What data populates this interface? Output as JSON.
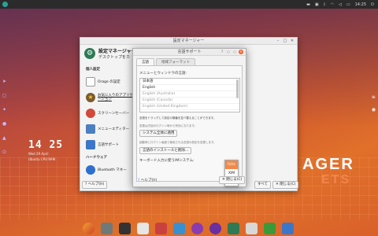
{
  "tray": {
    "time": "14:25"
  },
  "desktop": {
    "clock": "14 25",
    "date": "Wed  29  April",
    "info": "Ubuntu  CPU  RAM",
    "word1": "AGER",
    "word2": "ETS"
  },
  "main_window": {
    "title": "設定マネージャー",
    "header_title": "設定マネージャー",
    "header_subtitle": "デスクトップをカ",
    "category_personal": "個人設定",
    "category_hardware": "ハードウェア",
    "items": [
      {
        "label": "Orage の設定",
        "underline": false
      },
      {
        "label": "お気に入りのアプリケーション",
        "underline": true
      },
      {
        "label": "スクリーンセーバー",
        "underline": false
      },
      {
        "label": "メニューエディター",
        "underline": false
      },
      {
        "label": "言語サポート",
        "underline": false
      },
      {
        "label": "Bluetooth マネー",
        "underline": false
      }
    ],
    "help_button": "ヘルプ(H)",
    "close_button": "閉じる(C)",
    "all_button": "すべて"
  },
  "dialog": {
    "title": "言語サポート",
    "tabs": [
      "言語",
      "地域フォーマット"
    ],
    "section_label": "メニューとウィンドウの言語:",
    "languages": [
      {
        "name": "日本語",
        "dim": false
      },
      {
        "name": "English",
        "dim": false
      },
      {
        "name": "English (Australia)",
        "dim": true
      },
      {
        "name": "English (Canada)",
        "dim": true
      },
      {
        "name": "English (United Kingdom)",
        "dim": true
      }
    ],
    "hint1": "言語をドラッグして設定の順番を並べ替えることができます。",
    "hint1b": "変更は次回のログイン時から有効になります。",
    "apply_button": "システム全体に適用",
    "hint2": "起動時とログイン画面で使用される言語の設定を変更します。",
    "install_button": "言語のインストールと削除...",
    "keyboard_label": "キーボード入力に使うIMシステム:",
    "popup_options": [
      "fcitx",
      "XIM",
      "なし"
    ],
    "popup_selected": "fcitx",
    "help_button": "ヘルプ(H)",
    "close_button": "閉じる(C)"
  }
}
